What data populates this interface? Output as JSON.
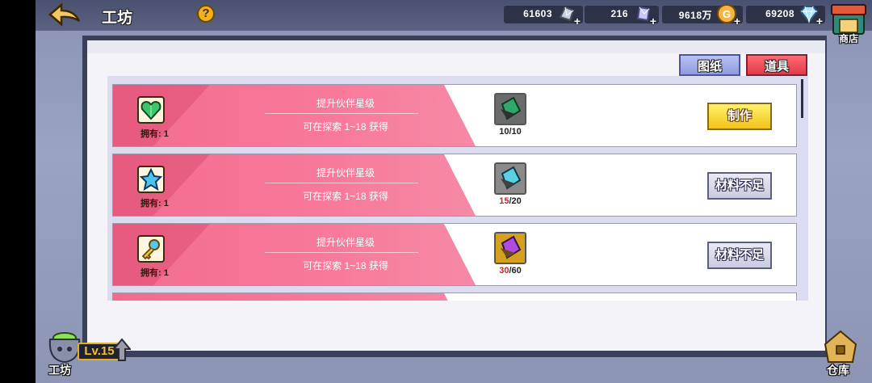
{
  "header": {
    "title": "工坊",
    "help_label": "?"
  },
  "resources": [
    {
      "name": "silver-ore",
      "value": "61603",
      "icon": "silver-crystal-icon"
    },
    {
      "name": "purple-crystal",
      "value": "216",
      "icon": "purple-crystal-icon"
    },
    {
      "name": "gold-coin",
      "value": "9618万",
      "icon": "gold-coin-icon"
    },
    {
      "name": "diamond",
      "value": "69208",
      "icon": "diamond-icon"
    }
  ],
  "shop": {
    "label": "商店"
  },
  "tabs": [
    {
      "label": "图纸",
      "active": false
    },
    {
      "label": "道具",
      "active": true
    }
  ],
  "recipes": [
    {
      "item_icon": "heart-gem-icon",
      "owned_label": "拥有: 1",
      "desc": "提升伙伴星级",
      "source": "可在探索 1~18 获得",
      "material_icon": "green-shard-icon",
      "have": "10",
      "need": "/10",
      "action": "制作",
      "ready": true
    },
    {
      "item_icon": "blue-star-gem-icon",
      "owned_label": "拥有: 1",
      "desc": "提升伙伴星级",
      "source": "可在探索 1~18 获得",
      "material_icon": "blue-shard-icon",
      "have": "15",
      "need": "/20",
      "action": "材料不足",
      "ready": false
    },
    {
      "item_icon": "gold-key-icon",
      "owned_label": "拥有: 1",
      "desc": "提升伙伴星级",
      "source": "可在探索 1~18 获得",
      "material_icon": "purple-shard-icon",
      "have": "30",
      "need": "/60",
      "action": "材料不足",
      "ready": false
    }
  ],
  "footer": {
    "workshop_label": "工坊",
    "level": "Lv.15",
    "warehouse_label": "仓库"
  },
  "colors": {
    "accent_pink": "#f36c8e",
    "ready_yellow": "#f2c21a",
    "tab_active_red": "#e33a4a",
    "tab_blue": "#8f9be0",
    "insufficient_red": "#d0202a"
  }
}
